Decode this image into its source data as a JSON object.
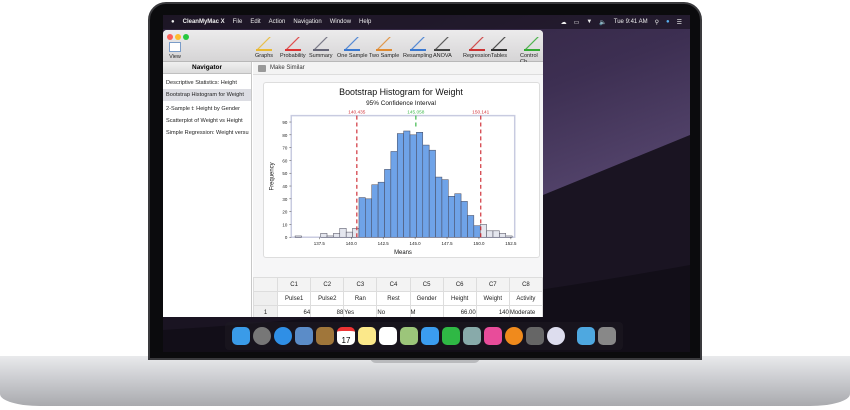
{
  "menubar": {
    "app": "CleanMyMac X",
    "items": [
      "File",
      "Edit",
      "Action",
      "Navigation",
      "Window",
      "Help"
    ],
    "clock": "Tue 9:41 AM"
  },
  "toolbar": {
    "view": "View",
    "buttons": [
      "Graphs",
      "Probability",
      "Summary",
      "One Sample",
      "Two Sample",
      "Resampling",
      "ANOVA",
      "Regression",
      "Tables",
      "Control Ch"
    ]
  },
  "navigator": {
    "title": "Navigator",
    "items": [
      "Descriptive Statistics: Height",
      "Bootstrap Histogram for Weight",
      "2-Sample t: Height by Gender",
      "Scatterplot of Weight vs Height",
      "Simple Regression: Weight versu"
    ],
    "selected": 1
  },
  "main": {
    "make_similar": "Make Similar"
  },
  "chart_data": {
    "type": "bar",
    "title": "Bootstrap Histogram for Weight",
    "subtitle": "95% Confidence Interval",
    "xlabel": "Means",
    "ylabel": "Frequency",
    "bin_start": 135.6,
    "bin_width": 0.5,
    "values": [
      1,
      0,
      0,
      0,
      3,
      1,
      3,
      7,
      4,
      7,
      31,
      30,
      41,
      43,
      53,
      67,
      81,
      83,
      80,
      82,
      72,
      68,
      47,
      45,
      32,
      34,
      28,
      17,
      9,
      10,
      5,
      5,
      3,
      1
    ],
    "ci_lower": 140.435,
    "mean": 145.058,
    "ci_upper": 150.141,
    "ci_labels": [
      "140.435",
      "145.058",
      "150.141"
    ],
    "xlim": [
      135.3,
      152.8
    ],
    "ylim": [
      0,
      95
    ],
    "xticks": [
      "137.5",
      "140.0",
      "142.5",
      "145.0",
      "147.5",
      "150.0",
      "152.5"
    ],
    "yticks": [
      "0",
      "10",
      "20",
      "30",
      "40",
      "50",
      "60",
      "70",
      "80",
      "90"
    ],
    "colors": {
      "inside": "#6fa3e8",
      "outside": "#e4e6ee",
      "ci": "#d0323a",
      "mean": "#3cb84a"
    }
  },
  "worksheet": {
    "columns": [
      "C1",
      "C2",
      "C3",
      "C4",
      "C5",
      "C6",
      "C7",
      "C8"
    ],
    "names": [
      "Pulse1",
      "Pulse2",
      "Ran",
      "Rest",
      "Gender",
      "Height",
      "Weight",
      "Activity"
    ],
    "rows": [
      {
        "n": "1",
        "cells": [
          "64",
          "88",
          "Yes",
          "No",
          "M",
          "66.00",
          "140",
          "Moderate"
        ]
      }
    ]
  },
  "dock": [
    "finder",
    "launchpad",
    "safari",
    "preview",
    "contacts",
    "calendar",
    "notes",
    "reminders",
    "maps",
    "messages",
    "facetime",
    "photos",
    "minitab",
    "books",
    "system-preferences",
    "migration",
    "downloads",
    "trash"
  ],
  "dock_calendar_day": "17"
}
